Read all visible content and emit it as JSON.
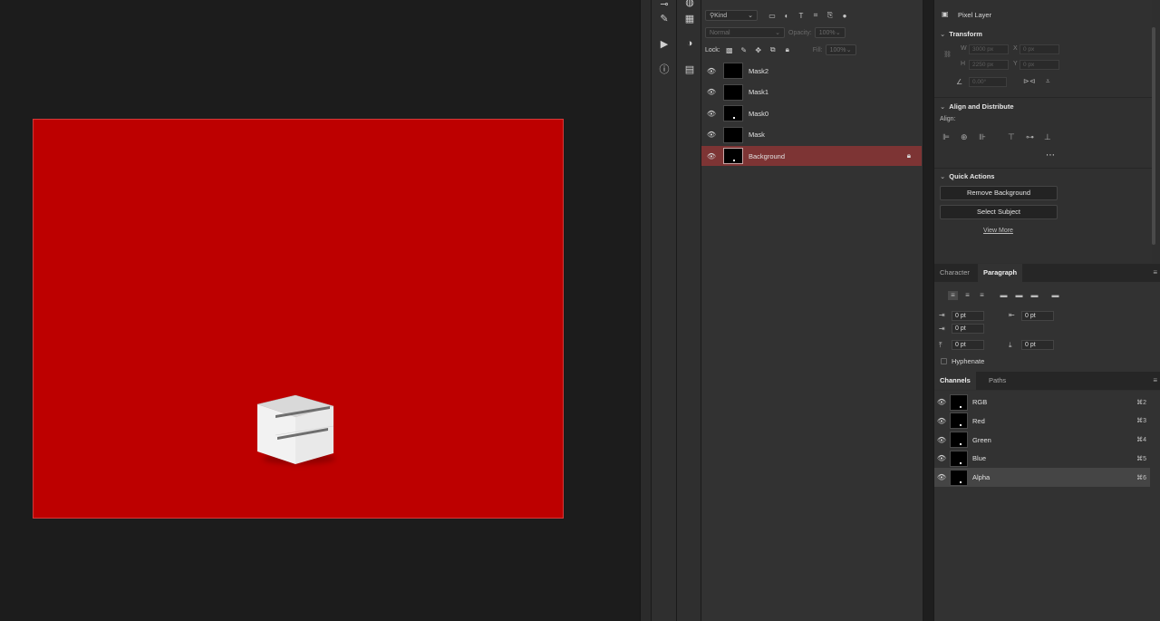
{
  "layers_panel": {
    "filter_kind": "Kind",
    "blend_mode": "Normal",
    "opacity_label": "Opacity:",
    "opacity_value": "100%",
    "lock_label": "Lock:",
    "fill_label": "Fill:",
    "fill_value": "100%",
    "layers": [
      {
        "name": "Mask2",
        "visible": true,
        "selected": false,
        "locked": false
      },
      {
        "name": "Mask1",
        "visible": true,
        "selected": false,
        "locked": false
      },
      {
        "name": "Mask0",
        "visible": true,
        "selected": false,
        "locked": false
      },
      {
        "name": "Mask",
        "visible": true,
        "selected": false,
        "locked": false
      },
      {
        "name": "Background",
        "visible": true,
        "selected": true,
        "locked": true
      }
    ]
  },
  "properties": {
    "layer_type": "Pixel Layer",
    "transform": {
      "title": "Transform",
      "w_label": "W",
      "w_value": "3000 px",
      "x_label": "X",
      "x_value": "0 px",
      "h_label": "H",
      "h_value": "2250 px",
      "y_label": "Y",
      "y_value": "0 px",
      "angle_value": "0.00°"
    },
    "align": {
      "title": "Align and Distribute",
      "align_label": "Align:"
    },
    "quick_actions": {
      "title": "Quick Actions",
      "remove_bg": "Remove Background",
      "select_subject": "Select Subject",
      "view_more": "View More"
    }
  },
  "type_tabs": {
    "character": "Character",
    "paragraph": "Paragraph"
  },
  "paragraph": {
    "indent_left": "0 pt",
    "indent_right": "0 pt",
    "indent_first": "0 pt",
    "space_before": "0 pt",
    "space_after": "0 pt",
    "hyphenate": "Hyphenate"
  },
  "channel_tabs": {
    "channels": "Channels",
    "paths": "Paths"
  },
  "channels": [
    {
      "name": "RGB",
      "shortcut": "⌘2",
      "selected": false
    },
    {
      "name": "Red",
      "shortcut": "⌘3",
      "selected": false
    },
    {
      "name": "Green",
      "shortcut": "⌘4",
      "selected": false
    },
    {
      "name": "Blue",
      "shortcut": "⌘5",
      "selected": false
    },
    {
      "name": "Alpha",
      "shortcut": "⌘6",
      "selected": true
    }
  ],
  "colors": {
    "canvas_red": "#bd0000",
    "selected_layer": "#7d3434",
    "panel_bg": "#323232"
  }
}
